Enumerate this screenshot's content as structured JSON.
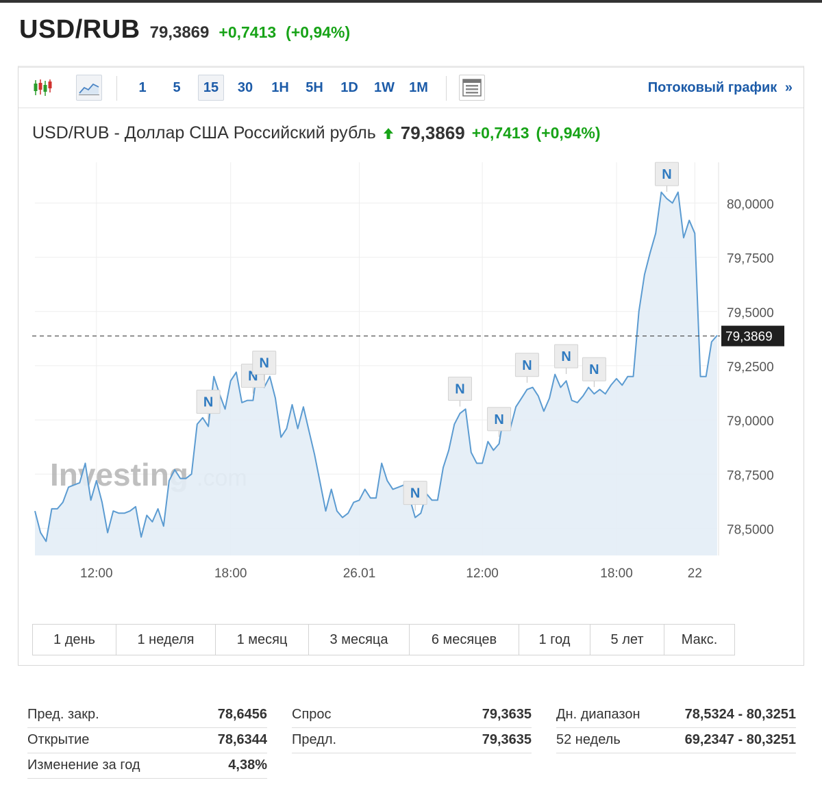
{
  "header": {
    "symbol": "USD/RUB",
    "price": "79,3869",
    "change": "+0,7413",
    "change_pct": "(+0,94%)",
    "change_color": "#17a317"
  },
  "toolbar": {
    "icons": [
      "candlestick-chart-icon",
      "area-chart-icon",
      "layout-icon"
    ],
    "timeframes": [
      "1",
      "5",
      "15",
      "30",
      "1H",
      "5H",
      "1D",
      "1W",
      "1M"
    ],
    "selected_timeframe": "15",
    "streaming_label": "Потоковый график",
    "streaming_arrow": "»"
  },
  "chart_title": {
    "name": "USD/RUB - Доллар США Российский рубль",
    "price": "79,3869",
    "change": "+0,7413",
    "change_pct": "(+0,94%)"
  },
  "watermark": {
    "brand": "Investing",
    "suffix": ".com"
  },
  "chart_data": {
    "type": "area",
    "ylim": [
      78.375,
      80.175
    ],
    "y_ticks": [
      78.5,
      78.75,
      79.0,
      79.25,
      79.5,
      79.75,
      80.0
    ],
    "y_tick_labels": [
      "78,5000",
      "78,7500",
      "79,0000",
      "79,2500",
      "79,5000",
      "79,7500",
      "80,0000"
    ],
    "x_tick_labels": [
      "12:00",
      "18:00",
      "26.01",
      "12:00",
      "18:00",
      "22"
    ],
    "x_tick_index": [
      11,
      35,
      58,
      80,
      104,
      118
    ],
    "grid": true,
    "current_value": 79.3869,
    "current_label": "79,3869",
    "line_color": "#5b9bd1",
    "fill_color": "#e3edf6",
    "values": [
      78.58,
      78.48,
      78.44,
      78.59,
      78.59,
      78.62,
      78.69,
      78.7,
      78.71,
      78.8,
      78.63,
      78.72,
      78.62,
      78.48,
      78.58,
      78.57,
      78.57,
      78.58,
      78.6,
      78.46,
      78.56,
      78.53,
      78.59,
      78.51,
      78.72,
      78.77,
      78.73,
      78.73,
      78.75,
      78.98,
      79.01,
      78.97,
      79.2,
      79.12,
      79.05,
      79.18,
      79.22,
      79.08,
      79.09,
      79.09,
      79.28,
      79.15,
      79.2,
      79.1,
      78.92,
      78.96,
      79.07,
      78.96,
      79.06,
      78.95,
      78.84,
      78.71,
      78.58,
      78.68,
      78.58,
      78.55,
      78.57,
      78.62,
      78.63,
      78.68,
      78.64,
      78.64,
      78.8,
      78.72,
      78.68,
      78.69,
      78.7,
      78.64,
      78.55,
      78.57,
      78.66,
      78.63,
      78.63,
      78.78,
      78.86,
      78.98,
      79.03,
      79.05,
      78.85,
      78.8,
      78.8,
      78.9,
      78.86,
      78.89,
      79.05,
      78.96,
      79.06,
      79.1,
      79.14,
      79.15,
      79.11,
      79.04,
      79.1,
      79.21,
      79.15,
      79.18,
      79.09,
      79.08,
      79.11,
      79.15,
      79.12,
      79.14,
      79.12,
      79.16,
      79.19,
      79.16,
      79.2,
      79.2,
      79.5,
      79.67,
      79.77,
      79.86,
      80.05,
      80.02,
      80.0,
      80.05,
      79.84,
      79.92,
      79.86,
      79.2,
      79.2,
      79.36,
      79.39
    ],
    "news_markers": [
      {
        "index": 31,
        "label": "N"
      },
      {
        "index": 39,
        "label": "N"
      },
      {
        "index": 41,
        "label": "N"
      },
      {
        "index": 68,
        "label": "N"
      },
      {
        "index": 76,
        "label": "N"
      },
      {
        "index": 83,
        "label": "N"
      },
      {
        "index": 88,
        "label": "N"
      },
      {
        "index": 95,
        "label": "N"
      },
      {
        "index": 100,
        "label": "N"
      },
      {
        "index": 113,
        "label": "N"
      }
    ]
  },
  "ranges": [
    "1 день",
    "1 неделя",
    "1 месяц",
    "3 месяца",
    "6 месяцев",
    "1 год",
    "5 лет",
    "Макс."
  ],
  "stats": {
    "col1": [
      {
        "k": "Пред. закр.",
        "v": "78,6456"
      },
      {
        "k": "Открытие",
        "v": "78,6344"
      },
      {
        "k": "Изменение за год",
        "v": "4,38%"
      }
    ],
    "col2": [
      {
        "k": "Спрос",
        "v": "79,3635"
      },
      {
        "k": "Предл.",
        "v": "79,3635"
      }
    ],
    "col3": [
      {
        "k": "Дн. диапазон",
        "v": "78,5324 - 80,3251"
      },
      {
        "k": "52 недель",
        "v": "69,2347 - 80,3251"
      }
    ]
  }
}
